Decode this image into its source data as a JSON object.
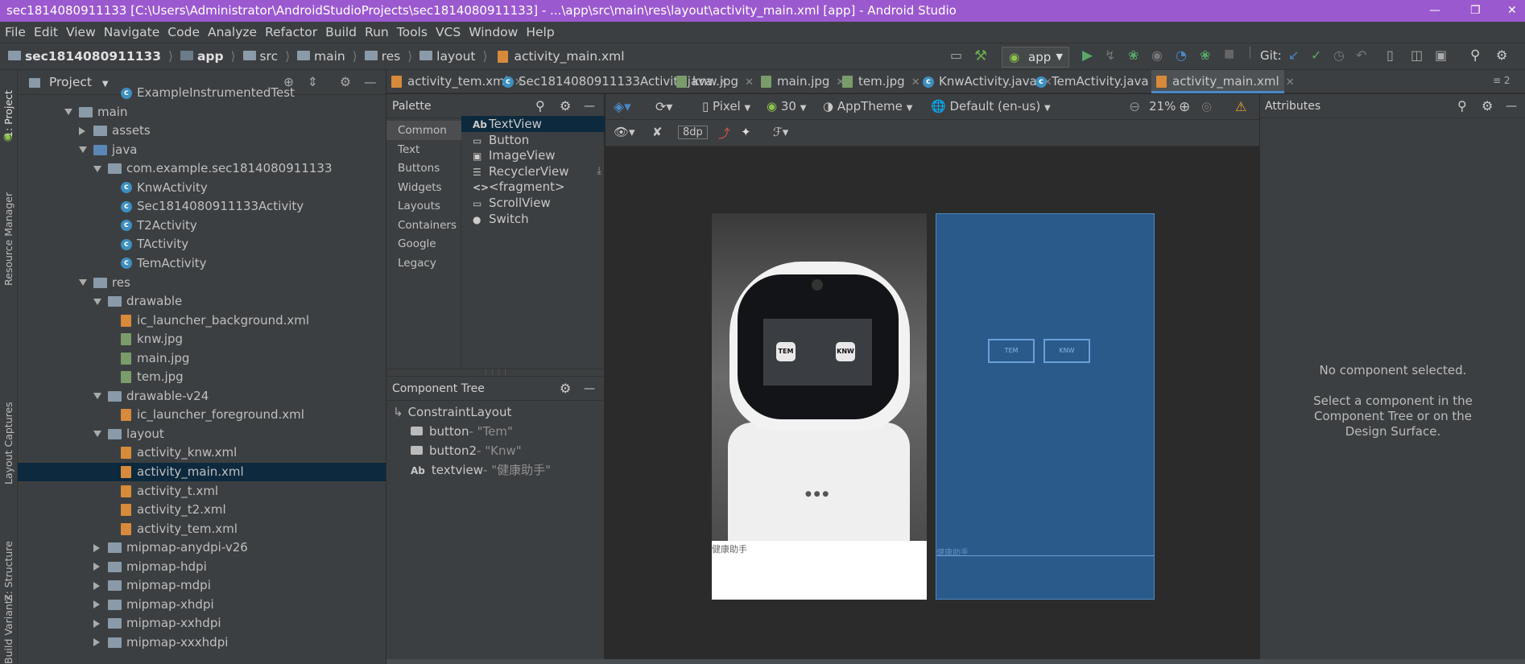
{
  "window": {
    "title": "sec1814080911133 [C:\\Users\\Administrator\\AndroidStudioProjects\\sec1814080911133] - ...\\app\\src\\main\\res\\layout\\activity_main.xml [app] - Android Studio",
    "accent_color": "#9b59d0"
  },
  "menu": [
    "File",
    "Edit",
    "View",
    "Navigate",
    "Code",
    "Analyze",
    "Refactor",
    "Build",
    "Run",
    "Tools",
    "VCS",
    "Window",
    "Help"
  ],
  "breadcrumb": {
    "project": "sec1814080911133",
    "items": [
      "app",
      "src",
      "main",
      "res",
      "layout",
      "activity_main.xml"
    ]
  },
  "toolbar": {
    "run_config": "app",
    "git_label": "Git:"
  },
  "left_strip": {
    "tabs": [
      "1: Project",
      "Resource Manager",
      "Layout Captures",
      "Z: Structure",
      "Build Variants"
    ]
  },
  "project_panel": {
    "header": "Project",
    "tree": [
      {
        "label": "ExampleInstrumentedTest",
        "type": "class"
      },
      {
        "label": "main",
        "type": "folder",
        "expanded": true
      },
      {
        "label": "assets",
        "type": "folder",
        "expanded": false
      },
      {
        "label": "java",
        "type": "folder-blue",
        "expanded": true
      },
      {
        "label": "com.example.sec1814080911133",
        "type": "folder",
        "expanded": true
      },
      {
        "label": "KnwActivity",
        "type": "class"
      },
      {
        "label": "Sec1814080911133Activity",
        "type": "class"
      },
      {
        "label": "T2Activity",
        "type": "class"
      },
      {
        "label": "TActivity",
        "type": "class"
      },
      {
        "label": "TemActivity",
        "type": "class"
      },
      {
        "label": "res",
        "type": "folder",
        "expanded": true
      },
      {
        "label": "drawable",
        "type": "folder",
        "expanded": true
      },
      {
        "label": "ic_launcher_background.xml",
        "type": "xml"
      },
      {
        "label": "knw.jpg",
        "type": "img"
      },
      {
        "label": "main.jpg",
        "type": "img"
      },
      {
        "label": "tem.jpg",
        "type": "img"
      },
      {
        "label": "drawable-v24",
        "type": "folder",
        "expanded": true
      },
      {
        "label": "ic_launcher_foreground.xml",
        "type": "xml"
      },
      {
        "label": "layout",
        "type": "folder",
        "expanded": true
      },
      {
        "label": "activity_knw.xml",
        "type": "xml"
      },
      {
        "label": "activity_main.xml",
        "type": "xml",
        "selected": true
      },
      {
        "label": "activity_t.xml",
        "type": "xml"
      },
      {
        "label": "activity_t2.xml",
        "type": "xml"
      },
      {
        "label": "activity_tem.xml",
        "type": "xml"
      },
      {
        "label": "mipmap-anydpi-v26",
        "type": "folder",
        "expanded": false
      },
      {
        "label": "mipmap-hdpi",
        "type": "folder",
        "expanded": false
      },
      {
        "label": "mipmap-mdpi",
        "type": "folder",
        "expanded": false
      },
      {
        "label": "mipmap-xhdpi",
        "type": "folder",
        "expanded": false
      },
      {
        "label": "mipmap-xxhdpi",
        "type": "folder",
        "expanded": false
      },
      {
        "label": "mipmap-xxxhdpi",
        "type": "folder",
        "expanded": false
      }
    ]
  },
  "editor_tabs": [
    {
      "label": "activity_tem.xml",
      "kind": "xml"
    },
    {
      "label": "Sec1814080911133Activity.java",
      "kind": "class"
    },
    {
      "label": "knw.jpg",
      "kind": "img"
    },
    {
      "label": "main.jpg",
      "kind": "img"
    },
    {
      "label": "tem.jpg",
      "kind": "img"
    },
    {
      "label": "KnwActivity.java",
      "kind": "class"
    },
    {
      "label": "TemActivity.java",
      "kind": "class"
    },
    {
      "label": "activity_main.xml",
      "kind": "xml",
      "active": true
    }
  ],
  "tabs_overflow": "≡ 2",
  "palette": {
    "title": "Palette",
    "categories": [
      "Common",
      "Text",
      "Buttons",
      "Widgets",
      "Layouts",
      "Containers",
      "Google",
      "Legacy"
    ],
    "selected_category": "Common",
    "items": [
      {
        "icon": "Ab",
        "label": "TextView"
      },
      {
        "icon": "▭",
        "label": "Button"
      },
      {
        "icon": "▣",
        "label": "ImageView"
      },
      {
        "icon": "☰",
        "label": "RecyclerView"
      },
      {
        "icon": "<>",
        "label": "<fragment>"
      },
      {
        "icon": "▭",
        "label": "ScrollView"
      },
      {
        "icon": "●",
        "label": "Switch"
      }
    ]
  },
  "component_tree": {
    "title": "Component Tree",
    "root": "ConstraintLayout",
    "children": [
      {
        "name": "button",
        "text": "- \"Tem\""
      },
      {
        "name": "button2",
        "text": "- \"Knw\""
      },
      {
        "name": "textview",
        "text": "- \"健康助手\""
      }
    ]
  },
  "design_toolbar": {
    "device": "Pixel",
    "api": "30",
    "theme": "AppTheme",
    "locale": "Default (en-us)",
    "zoom": "21%",
    "margin": "8dp"
  },
  "preview": {
    "caption": "健康助手",
    "btn_tem": "TEM",
    "btn_knw": "KNW"
  },
  "attributes": {
    "title": "Attributes",
    "empty_title": "No component selected.",
    "empty_hint": "Select a component in the Component Tree or on the Design Surface."
  }
}
